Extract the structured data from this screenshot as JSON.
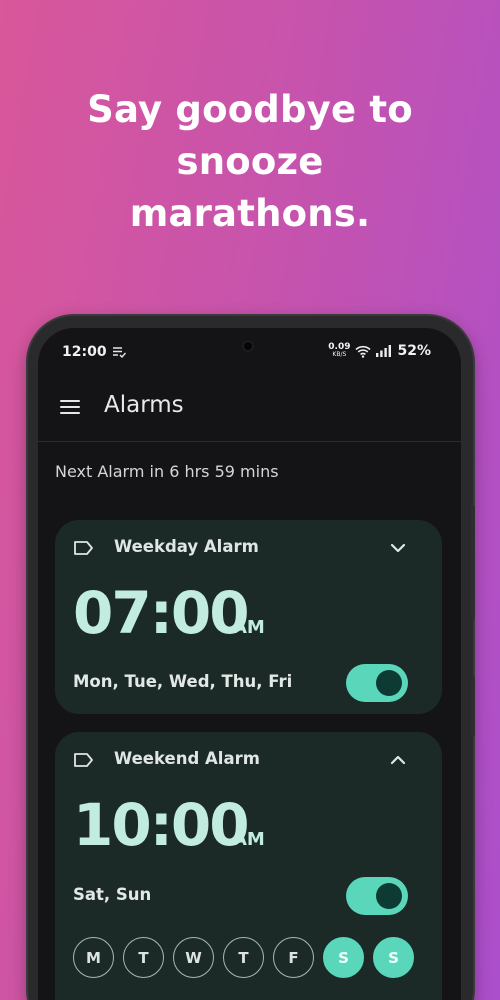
{
  "headline": {
    "line1": "Say goodbye to",
    "line2": "snooze",
    "line3": "marathons."
  },
  "status_bar": {
    "time": "12:00",
    "net_speed_value": "0.09",
    "net_speed_unit": "KB/S",
    "battery": "52%"
  },
  "app_bar": {
    "title": "Alarms",
    "menu_icon": "menu-icon"
  },
  "next_alarm_text": "Next Alarm in 6 hrs 59 mins",
  "alarms": [
    {
      "label": "Weekday Alarm",
      "time": "07:00",
      "ampm": "AM",
      "days": "Mon, Tue, Wed, Thu, Fri",
      "enabled": true,
      "expanded": false
    },
    {
      "label": "Weekend Alarm",
      "time": "10:00",
      "ampm": "AM",
      "days": "Sat, Sun",
      "enabled": true,
      "expanded": true,
      "day_buttons": [
        {
          "letter": "M",
          "selected": false
        },
        {
          "letter": "T",
          "selected": false
        },
        {
          "letter": "W",
          "selected": false
        },
        {
          "letter": "T",
          "selected": false
        },
        {
          "letter": "F",
          "selected": false
        },
        {
          "letter": "S",
          "selected": true
        },
        {
          "letter": "S",
          "selected": true
        }
      ]
    }
  ],
  "colors": {
    "accent": "#5ad7bb",
    "card_bg": "#1c2a27",
    "time_text": "#c3ece0",
    "screen_bg": "#141416"
  }
}
